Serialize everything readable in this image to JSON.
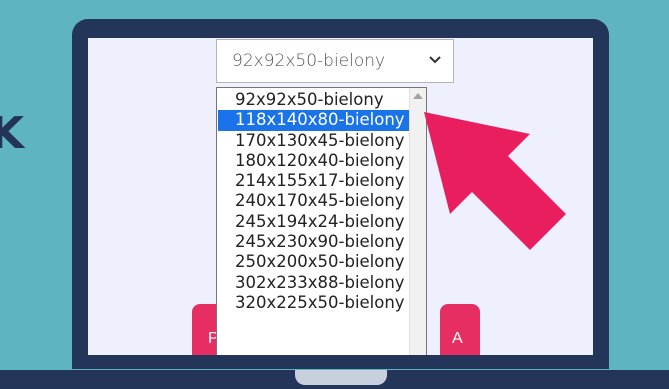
{
  "side_letter": "K",
  "select": {
    "value": "92x92x50-bielony",
    "options": [
      "92x92x50-bielony",
      "118x140x80-bielony",
      "170x130x45-bielony",
      "180x120x40-bielony",
      "214x155x17-bielony",
      "240x170x45-bielony",
      "245x194x24-bielony",
      "245x230x90-bielony",
      "250x200x50-bielony",
      "302x233x88-bielony",
      "320x225x50-bielony"
    ],
    "highlighted_option": "118x140x80-bielony"
  },
  "buttons": {
    "left_fragment": "P",
    "right_fragment": "A"
  },
  "colors": {
    "background": "#5fb4c1",
    "laptop": "#23365a",
    "arrow": "#e91e5e",
    "highlight": "#1a73e8"
  }
}
